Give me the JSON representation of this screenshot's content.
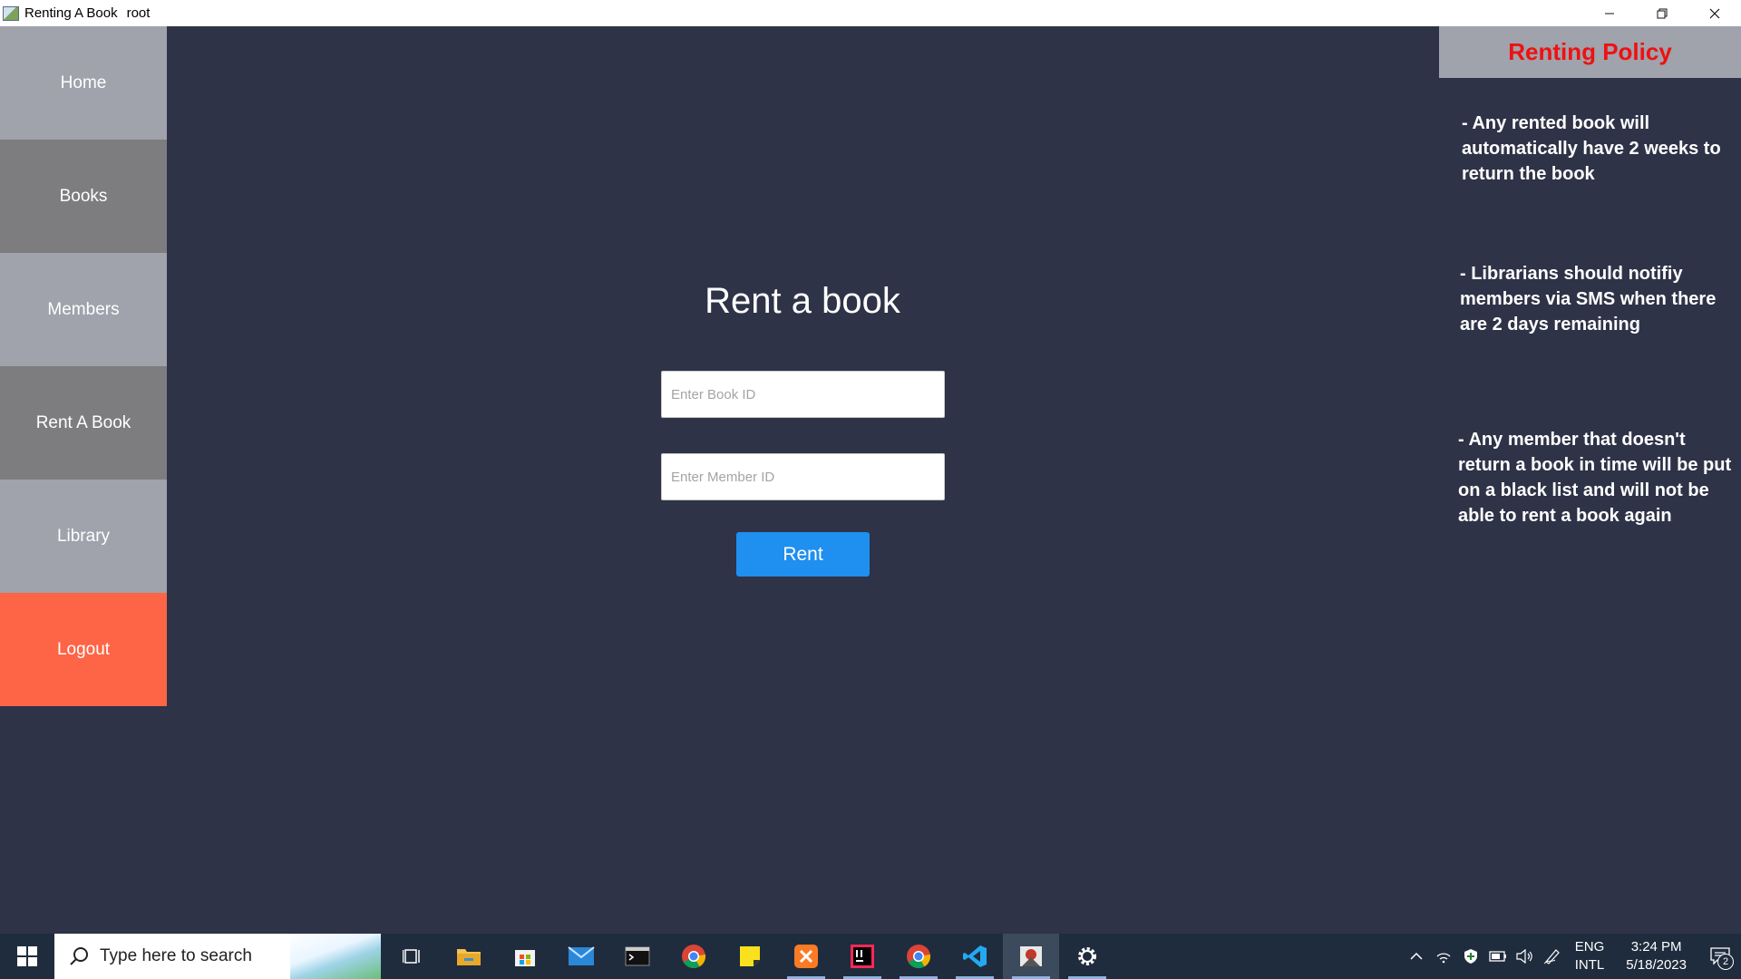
{
  "window": {
    "title": "Renting A Book",
    "user": "root",
    "controls": {
      "minimize": "—",
      "restore": "❐",
      "close": "✕"
    }
  },
  "sidebar": {
    "items": [
      {
        "label": "Home"
      },
      {
        "label": "Books"
      },
      {
        "label": "Members"
      },
      {
        "label": "Rent A Book"
      },
      {
        "label": "Library"
      },
      {
        "label": "Logout"
      }
    ]
  },
  "form": {
    "title": "Rent a book",
    "book_id_placeholder": "Enter Book ID",
    "member_id_placeholder": "Enter Member ID",
    "submit_label": "Rent"
  },
  "policy": {
    "title": "Renting Policy",
    "items": [
      "- Any rented book will automatically have 2 weeks to return the book",
      "- Librarians should notifiy members via SMS when there are 2 days remaining",
      "- Any member that doesn't return a book in time will be put on a black list and will not be able to rent a book again"
    ]
  },
  "taskbar": {
    "search_placeholder": "Type here to search",
    "icons": [
      "windows-start-icon",
      "task-view-icon",
      "file-explorer-icon",
      "microsoft-store-icon",
      "mail-icon",
      "terminal-icon",
      "chrome-icon",
      "sticky-notes-icon",
      "xampp-icon",
      "intellij-icon",
      "chrome-icon",
      "vscode-icon",
      "java-app-icon",
      "settings-icon"
    ],
    "language": "ENG",
    "layout": "INTL",
    "time": "3:24 PM",
    "date": "5/18/2023",
    "notification_count": "2"
  },
  "colors": {
    "background": "#2e3347",
    "sidebar_light": "#a0a2ac",
    "sidebar_dark": "#7d7d7f",
    "logout": "#fe6446",
    "accent_button": "#1f8ff0",
    "policy_title": "#ee1111"
  }
}
